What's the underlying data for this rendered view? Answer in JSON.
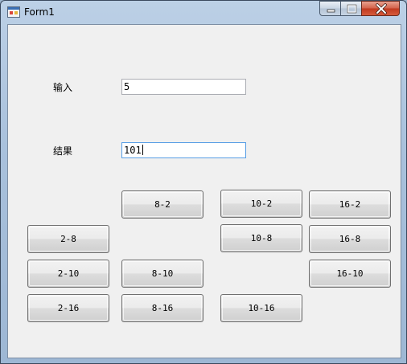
{
  "window": {
    "title": "Form1"
  },
  "titlebar": {
    "controls": [
      "minimize-icon",
      "maximize-icon",
      "close-icon"
    ]
  },
  "form": {
    "input_label": "输入",
    "input_value": "5",
    "result_label": "结果",
    "result_value": "101"
  },
  "buttons": {
    "b8_2": "8-2",
    "b10_2": "10-2",
    "b16_2": "16-2",
    "b2_8": "2-8",
    "b10_8": "10-8",
    "b16_8": "16-8",
    "b2_10": "2-10",
    "b8_10": "8-10",
    "b16_10": "16-10",
    "b2_16": "2-16",
    "b8_16": "8-16",
    "b10_16": "10-16"
  },
  "colors": {
    "accent_focus": "#569de5",
    "client_bg": "#f0f0f0",
    "close_red": "#c0391f"
  }
}
